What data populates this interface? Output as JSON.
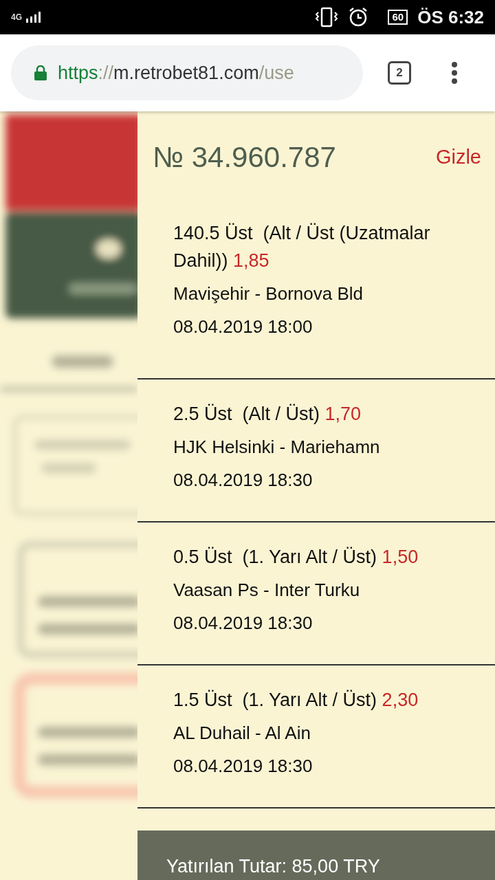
{
  "status_bar": {
    "network": "4G",
    "battery": "60",
    "time": "ÖS 6:32"
  },
  "browser": {
    "url_scheme": "https",
    "url_separator": "://",
    "url_host": "m.retrobet81.com",
    "url_path": "/use",
    "tab_count": "2"
  },
  "coupon": {
    "number": "№ 34.960.787",
    "hide_label": "Gizle",
    "bets": [
      {
        "selection": "140.5 Üst",
        "market": "(Alt / Üst (Uzatmalar Dahil))",
        "odds": "1,85",
        "match": "Mavişehir - Bornova Bld",
        "datetime": "08.04.2019 18:00"
      },
      {
        "selection": "2.5 Üst",
        "market": "(Alt / Üst)",
        "odds": "1,70",
        "match": "HJK Helsinki - Mariehamn",
        "datetime": "08.04.2019 18:30"
      },
      {
        "selection": "0.5 Üst",
        "market": "(1. Yarı Alt / Üst)",
        "odds": "1,50",
        "match": "Vaasan Ps - Inter Turku",
        "datetime": "08.04.2019 18:30"
      },
      {
        "selection": "1.5 Üst",
        "market": "(1. Yarı Alt / Üst)",
        "odds": "2,30",
        "match": "AL Duhail - Al Ain",
        "datetime": "08.04.2019 18:30"
      }
    ],
    "footer": "Yatırılan Tutar: 85,00 TRY"
  }
}
